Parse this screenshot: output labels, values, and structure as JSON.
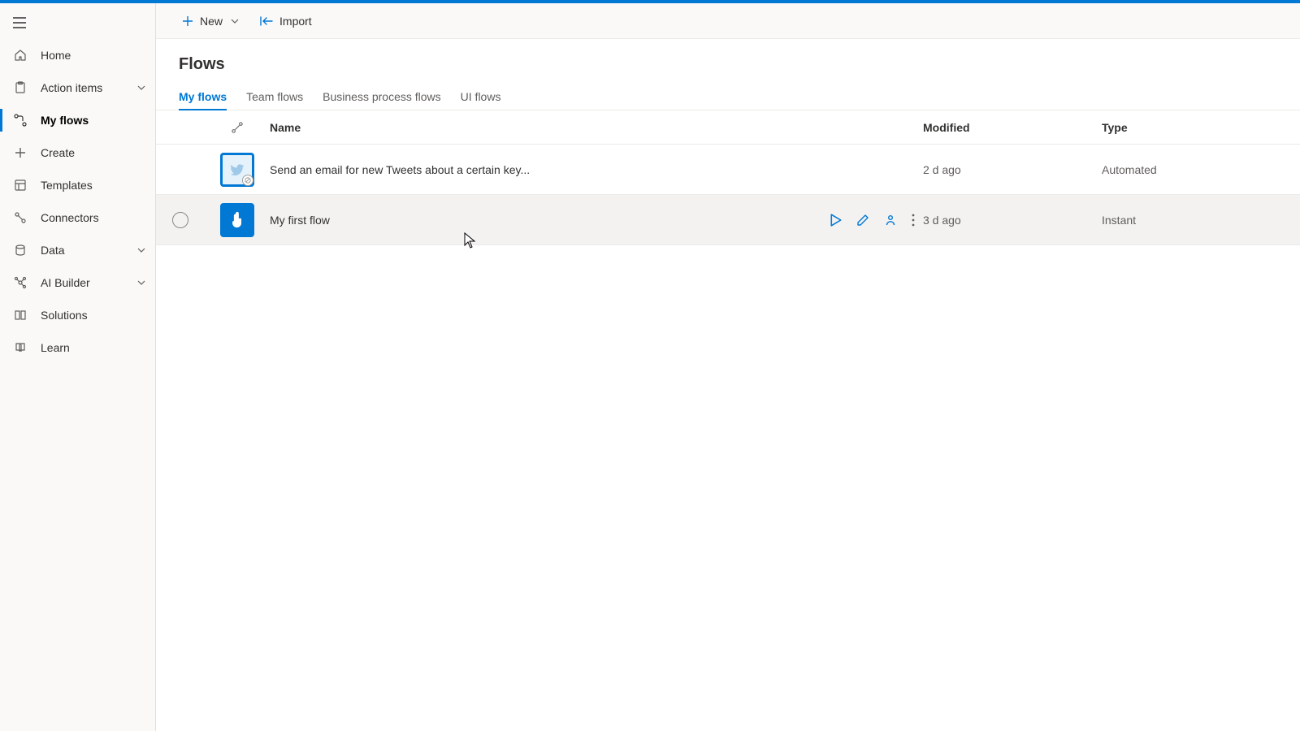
{
  "commandBar": {
    "newLabel": "New",
    "importLabel": "Import"
  },
  "sidebar": {
    "items": [
      {
        "id": "home",
        "label": "Home"
      },
      {
        "id": "action-items",
        "label": "Action items",
        "expandable": true
      },
      {
        "id": "my-flows",
        "label": "My flows",
        "sub": true,
        "active": true
      },
      {
        "id": "create",
        "label": "Create"
      },
      {
        "id": "templates",
        "label": "Templates"
      },
      {
        "id": "connectors",
        "label": "Connectors"
      },
      {
        "id": "data",
        "label": "Data",
        "expandable": true
      },
      {
        "id": "ai-builder",
        "label": "AI Builder",
        "expandable": true
      },
      {
        "id": "solutions",
        "label": "Solutions"
      },
      {
        "id": "learn",
        "label": "Learn"
      }
    ]
  },
  "page": {
    "title": "Flows",
    "tabs": [
      {
        "id": "my",
        "label": "My flows",
        "selected": true
      },
      {
        "id": "team",
        "label": "Team flows"
      },
      {
        "id": "bpf",
        "label": "Business process flows"
      },
      {
        "id": "ui",
        "label": "UI flows"
      }
    ],
    "columns": {
      "name": "Name",
      "modified": "Modified",
      "type": "Type"
    },
    "rows": [
      {
        "name": "Send an email for new Tweets about a certain key...",
        "modified": "2 d ago",
        "type": "Automated",
        "icon": "twitter"
      },
      {
        "name": "My first flow",
        "modified": "3 d ago",
        "type": "Instant",
        "icon": "manual",
        "hovered": true
      }
    ]
  }
}
